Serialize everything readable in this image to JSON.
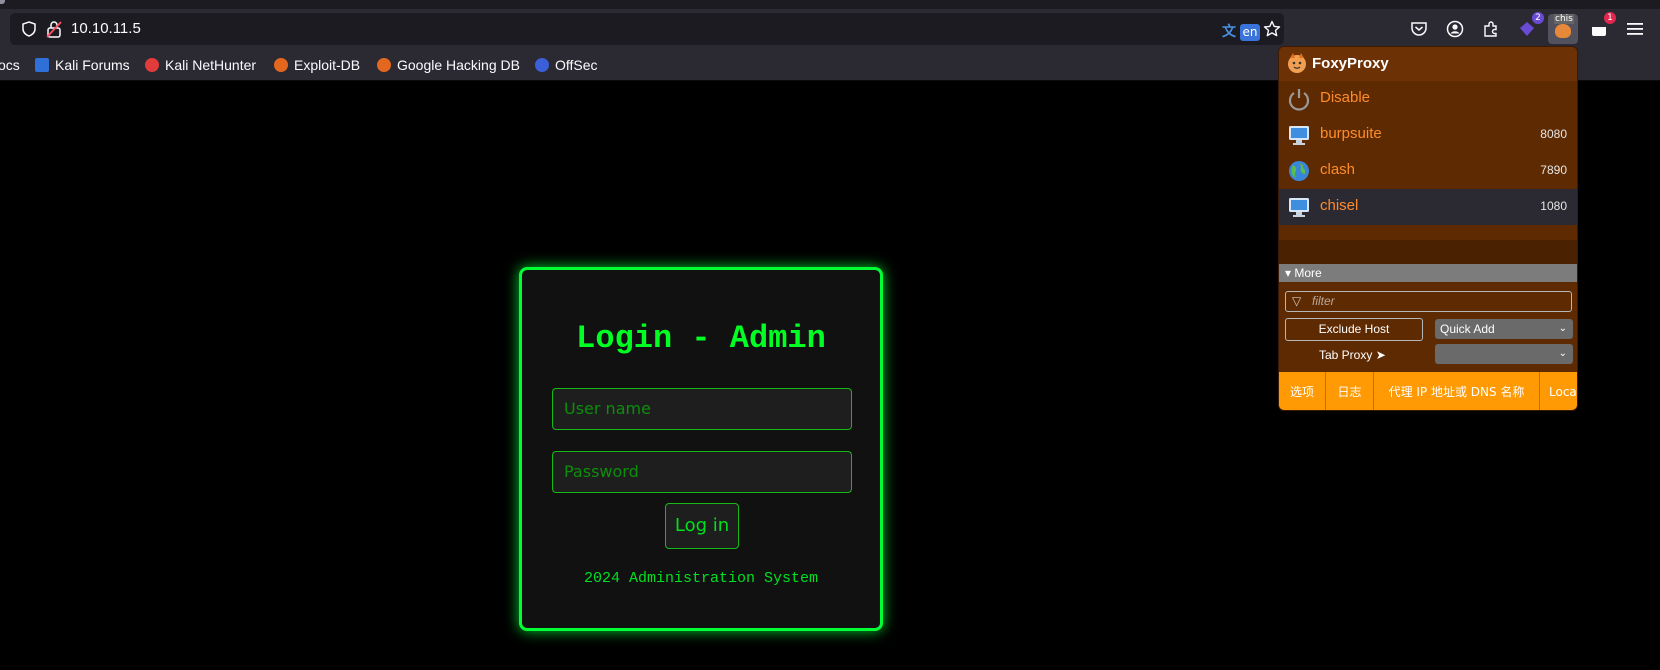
{
  "browser": {
    "url": "10.10.11.5",
    "translate_badge": "en",
    "extension_badges": {
      "first": "2",
      "foxy_label": "chis",
      "second": "1"
    }
  },
  "bookmarks": [
    {
      "label": "ocs",
      "icon": "docs-icon"
    },
    {
      "label": "Kali Forums",
      "icon": "kali-forums-icon"
    },
    {
      "label": "Kali NetHunter",
      "icon": "kali-nethunter-icon"
    },
    {
      "label": "Exploit-DB",
      "icon": "exploit-db-icon"
    },
    {
      "label": "Google Hacking DB",
      "icon": "ghdb-icon"
    },
    {
      "label": "OffSec",
      "icon": "offsec-icon"
    }
  ],
  "login": {
    "title": "Login - Admin",
    "username_placeholder": "User name",
    "password_placeholder": "Password",
    "button": "Log in",
    "footer": "2024 Administration System",
    "accent_color": "#00ff22"
  },
  "foxyproxy": {
    "title": "FoxyProxy",
    "disable_label": "Disable",
    "proxies": [
      {
        "name": "burpsuite",
        "port": "8080",
        "icon": "computer-icon"
      },
      {
        "name": "clash",
        "port": "7890",
        "icon": "globe-icon"
      },
      {
        "name": "chisel",
        "port": "1080",
        "icon": "computer-icon"
      }
    ],
    "more_label": "▾ More",
    "filter_placeholder": "filter",
    "exclude_host": "Exclude Host",
    "quick_add": "Quick Add",
    "tab_proxy": "Tab Proxy ➤",
    "tab_proxy_value": "",
    "footer_tabs": [
      "选项",
      "日志",
      "代理 IP 地址或 DNS 名称",
      "Loca"
    ]
  }
}
